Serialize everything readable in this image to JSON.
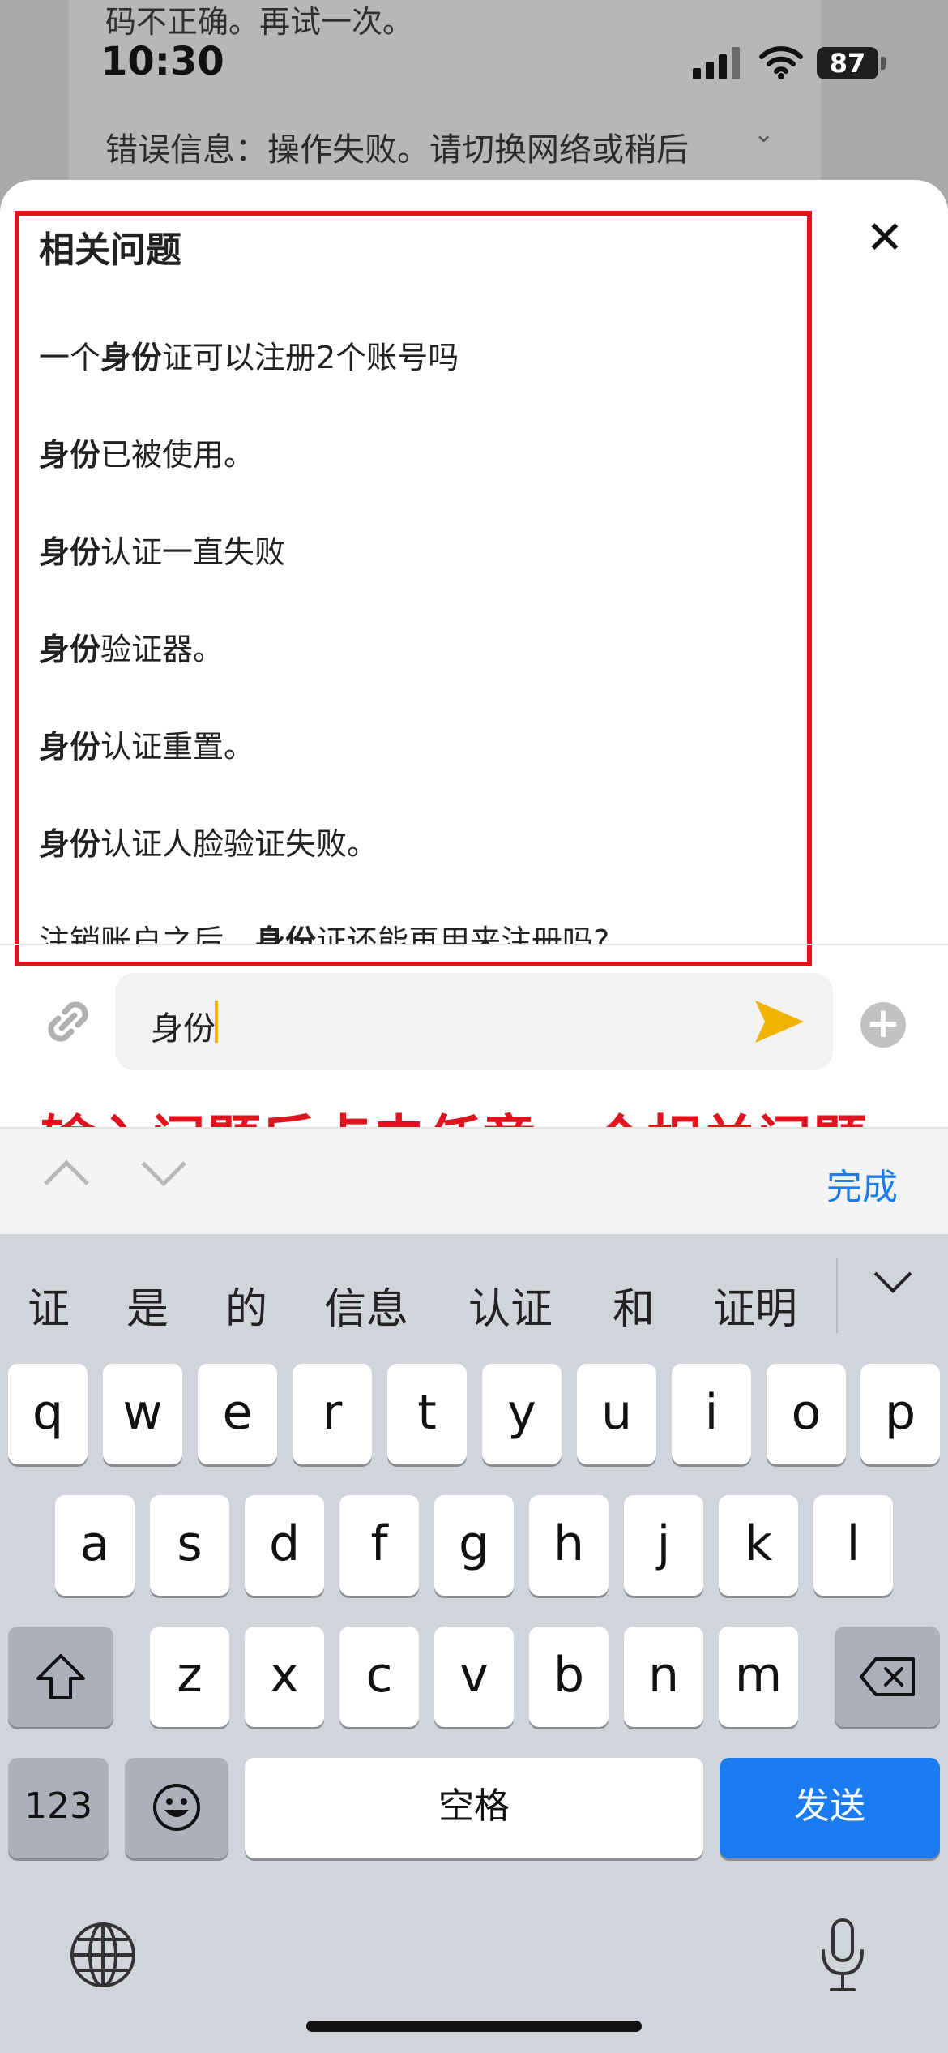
{
  "background": {
    "message_top": "码不正确。再试一次。",
    "error_message": "错误信息：操作失败。请切换网络或稍后"
  },
  "status_bar": {
    "time": "10:30",
    "battery": "87"
  },
  "sheet": {
    "title": "相关问题",
    "questions": [
      {
        "before": "一个",
        "bold": "身份",
        "after": "证可以注册2个账号吗"
      },
      {
        "before": "",
        "bold": "身份",
        "after": "已被使用。"
      },
      {
        "before": "",
        "bold": "身份",
        "after": "认证一直失败"
      },
      {
        "before": "",
        "bold": "身份",
        "after": "验证器。"
      },
      {
        "before": "",
        "bold": "身份",
        "after": "认证重置。"
      },
      {
        "before": "",
        "bold": "身份",
        "after": "认证人脸验证失败。"
      },
      {
        "before": "注销账户之后，",
        "bold": "身份",
        "after": "证还能再用来注册吗?"
      }
    ]
  },
  "input": {
    "value": "身份"
  },
  "annotation": "输入问题后点击任意一个相关问题",
  "toolbar": {
    "done": "完成"
  },
  "keyboard": {
    "candidates": [
      "证",
      "是",
      "的",
      "信息",
      "认证",
      "和",
      "证明"
    ],
    "row1": [
      "q",
      "w",
      "e",
      "r",
      "t",
      "y",
      "u",
      "i",
      "o",
      "p"
    ],
    "row2": [
      "a",
      "s",
      "d",
      "f",
      "g",
      "h",
      "j",
      "k",
      "l"
    ],
    "row3": [
      "z",
      "x",
      "c",
      "v",
      "b",
      "n",
      "m"
    ],
    "numbers_key": "123",
    "space_key": "空格",
    "send_key": "发送"
  },
  "colors": {
    "highlight_box": "#e0141e",
    "accent_blue": "#1a7cf0",
    "send_icon": "#f0b400"
  }
}
